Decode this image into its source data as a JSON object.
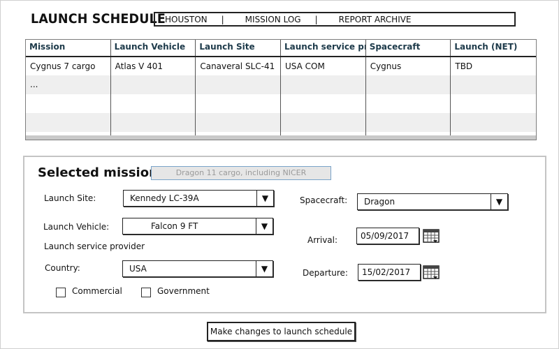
{
  "app": {
    "title": "LAUNCH SCHEDULE"
  },
  "nav": {
    "items": [
      "HOUSTON",
      "MISSION LOG",
      "REPORT ARCHIVE"
    ],
    "separator": "|"
  },
  "table": {
    "columns": [
      "Mission",
      "Launch Vehicle",
      "Launch Site",
      "Launch service provider",
      "Spacecraft",
      "Launch (NET)"
    ],
    "rows": [
      [
        "Cygnus 7 cargo",
        "Atlas V 401",
        "Canaveral SLC-41",
        "USA COM",
        "Cygnus",
        "TBD"
      ],
      [
        "...",
        "",
        "",
        "",
        "",
        ""
      ],
      [
        "",
        "",
        "",
        "",
        "",
        ""
      ],
      [
        "",
        "",
        "",
        "",
        "",
        ""
      ],
      [
        "",
        "",
        "",
        "",
        "",
        ""
      ]
    ]
  },
  "details": {
    "heading": "Selected mission:",
    "mission_name": "Dragon 11 cargo, including NICER",
    "launch_site": {
      "label": "Launch Site:",
      "value": "Kennedy LC-39A"
    },
    "launch_vehicle": {
      "label": "Launch Vehicle:",
      "value": "Falcon 9 FT"
    },
    "provider_label": "Launch service provider",
    "country": {
      "label": "Country:",
      "value": "USA"
    },
    "commercial_label": "Commercial",
    "government_label": "Government",
    "spacecraft": {
      "label": "Spacecraft:",
      "value": "Dragon"
    },
    "arrival": {
      "label": "Arrival:",
      "value": "05/09/2017"
    },
    "departure": {
      "label": "Departure:",
      "value": "15/02/2017"
    }
  },
  "actions": {
    "submit_label": "Make changes to launch schedule"
  },
  "icons": {
    "dropdown": "triangle-down-icon",
    "calendar": "calendar-icon"
  }
}
